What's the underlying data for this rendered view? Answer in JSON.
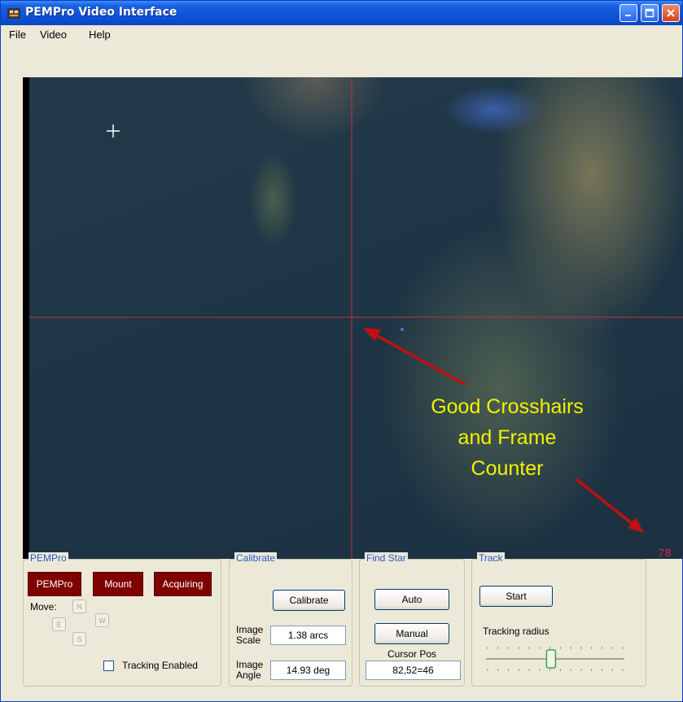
{
  "window": {
    "title": "PEMPro Video Interface"
  },
  "menu": [
    "File",
    "Video",
    "Help"
  ],
  "video": {
    "annotation_lines": [
      "Good Crosshairs",
      "and Frame",
      "Counter"
    ],
    "frame_counter": "78",
    "colors": {
      "crosshair": "#c0303a",
      "annotation": "#f2f200",
      "arrow": "#c01010"
    }
  },
  "pempro_group": {
    "title": "PEMPro",
    "buttons": [
      "PEMPro",
      "Mount",
      "Acquiring"
    ],
    "move_label": "Move:",
    "directions": {
      "n": "N",
      "e": "E",
      "w": "W",
      "s": "S"
    },
    "tracking_enabled_label": "Tracking Enabled",
    "tracking_enabled": false
  },
  "calibrate_group": {
    "title": "Calibrate",
    "calibrate_button": "Calibrate",
    "image_scale_label_1": "Image",
    "image_scale_label_2": "Scale",
    "image_scale_value": "1.38 arcs",
    "image_angle_label_1": "Image",
    "image_angle_label_2": "Angle",
    "image_angle_value": "14.93 deg"
  },
  "find_star_group": {
    "title": "Find Star",
    "auto_button": "Auto",
    "manual_button": "Manual",
    "cursor_pos_label": "Cursor Pos",
    "cursor_pos_value": "82,52=46"
  },
  "track_group": {
    "title": "Track",
    "start_button": "Start",
    "tracking_radius_label": "Tracking radius",
    "tracking_radius_level": 0.47
  }
}
